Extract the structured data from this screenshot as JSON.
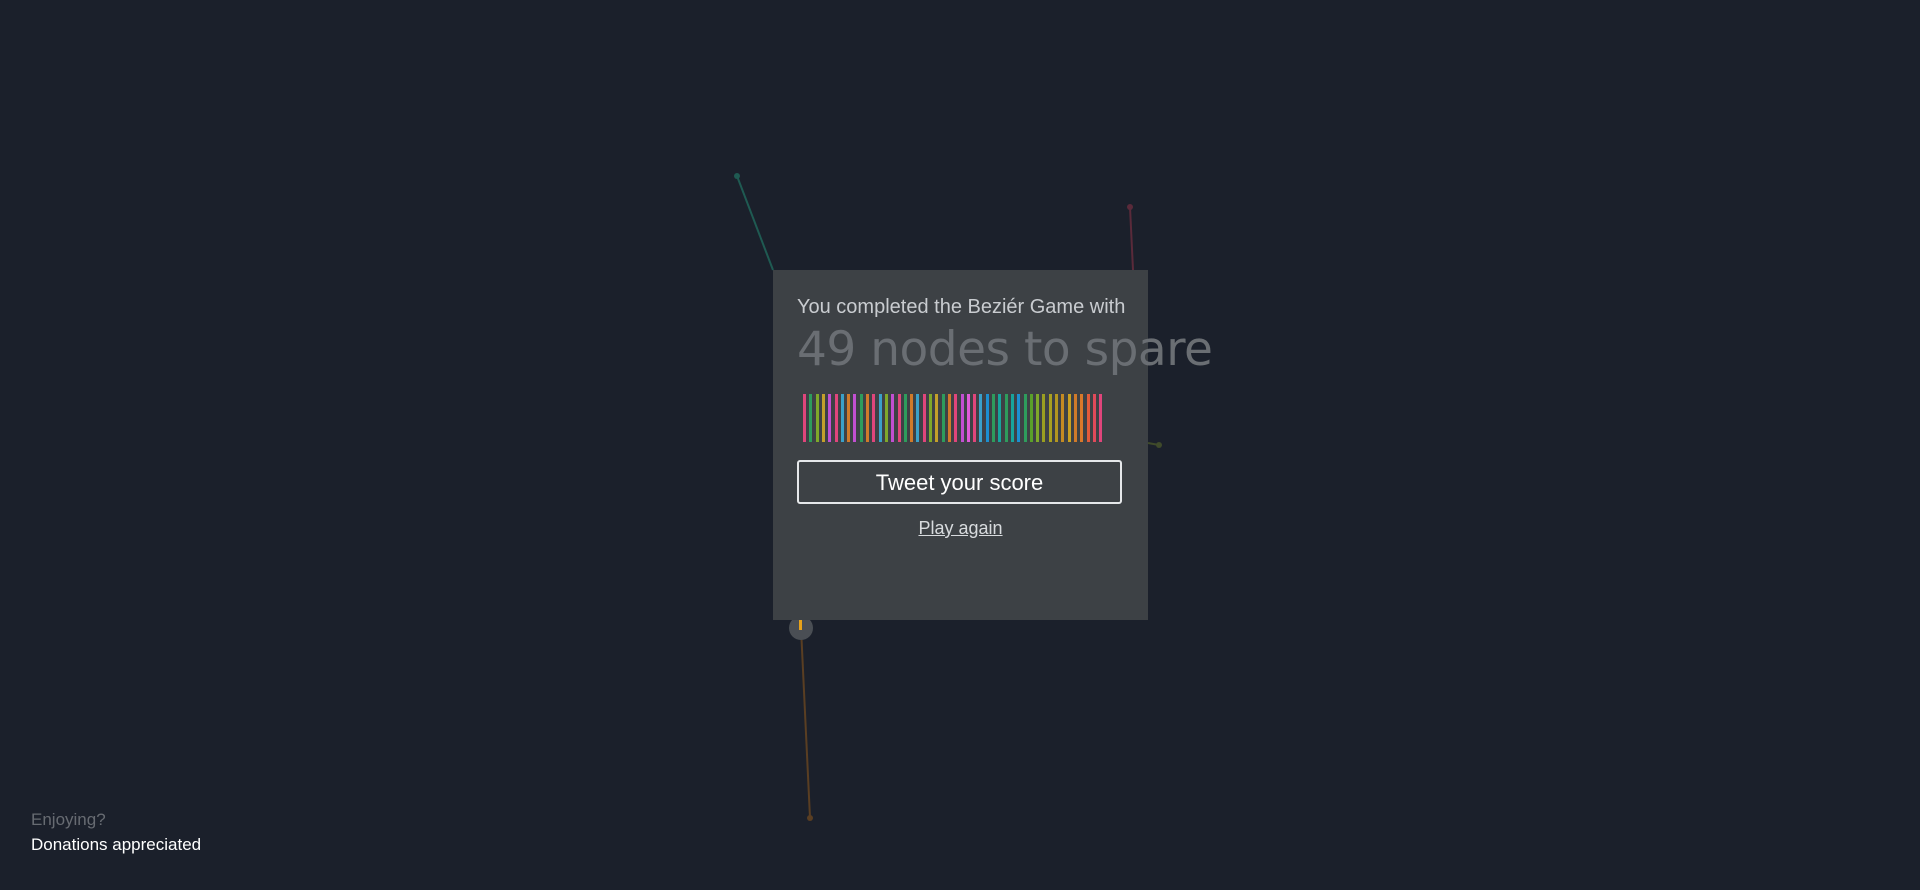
{
  "modal": {
    "intro": "You completed the Beziér Game with",
    "score": "49 nodes to spare",
    "tweet_label": "Tweet your score",
    "play_again_label": "Play again"
  },
  "node_colors": [
    "#e0457b",
    "#2e9c5c",
    "#7fa82a",
    "#c4a02a",
    "#c24fd1",
    "#e0457b",
    "#3aa0c9",
    "#d07a2a",
    "#c24fd1",
    "#2e9c5c",
    "#d07a2a",
    "#e0457b",
    "#3aa0c9",
    "#7fa82a",
    "#c24fd1",
    "#e0457b",
    "#2e9c5c",
    "#d07a2a",
    "#3aa0c9",
    "#e0457b",
    "#7fa82a",
    "#c4a02a",
    "#2e9c5c",
    "#d07a2a",
    "#e0457b",
    "#c24fd1",
    "#e05ad9",
    "#e0457b",
    "#3aa0c9",
    "#1c8fd0",
    "#2e9c5c",
    "#18a49b",
    "#2e9c5c",
    "#18a49b",
    "#1c8fd0",
    "#2e9c5c",
    "#5aa02a",
    "#7fa82a",
    "#9a9e20",
    "#a9a020",
    "#b39620",
    "#c48a22",
    "#c9a020",
    "#d07a2a",
    "#d8782a",
    "#e05a3a",
    "#e04a5a",
    "#e0457b"
  ],
  "colors": {
    "background": "#1b202b",
    "modal": "#3d4145",
    "curve_teal": "#1f5a52",
    "curve_red": "#5a2a3a",
    "curve_orange": "#5a3e22",
    "curve_olive": "#3f4a2a",
    "handle_accent": "#e8a21a"
  },
  "footer": {
    "enjoying": "Enjoying?",
    "donations": "Donations appreciated"
  }
}
